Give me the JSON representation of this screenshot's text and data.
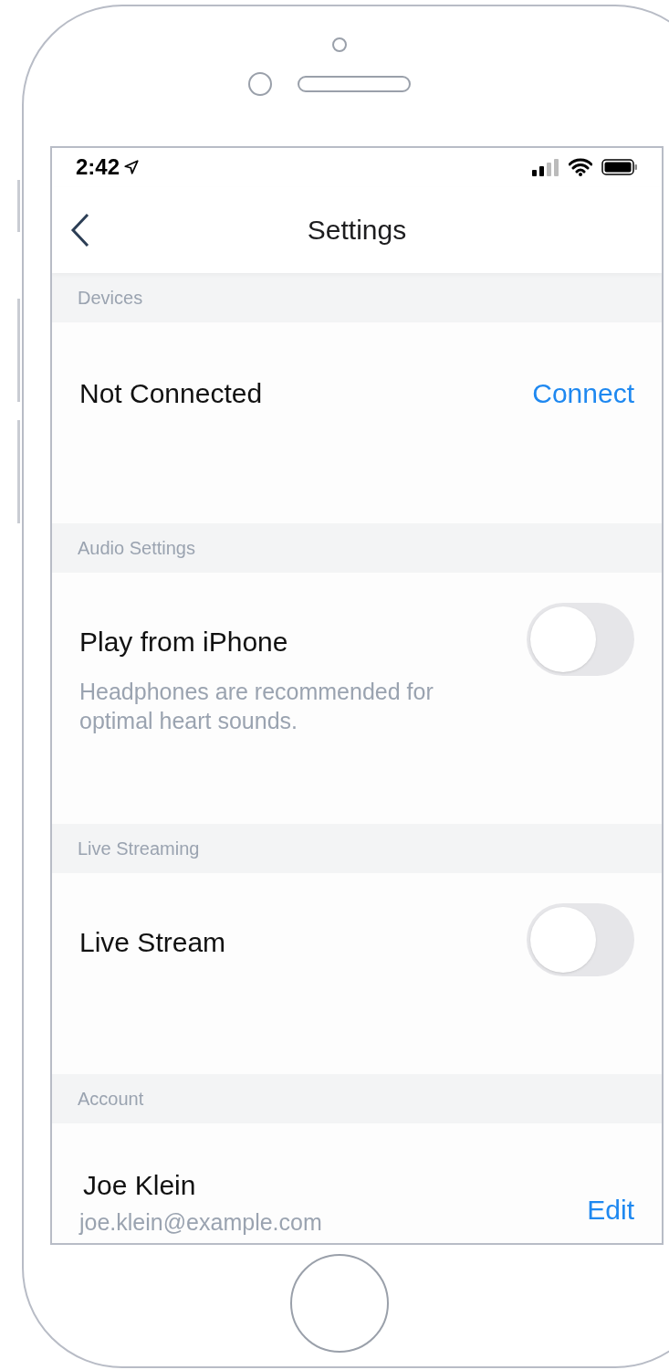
{
  "status_bar": {
    "time": "2:42"
  },
  "nav": {
    "title": "Settings"
  },
  "sections": [
    {
      "header": "Devices",
      "row": {
        "kind": "action",
        "label": "Not Connected",
        "action": "Connect"
      }
    },
    {
      "header": "Audio Settings",
      "row": {
        "kind": "toggle",
        "label": "Play from iPhone",
        "description": "Headphones are recommended for optimal heart sounds.",
        "on": false
      }
    },
    {
      "header": "Live Streaming",
      "row": {
        "kind": "toggle",
        "label": "Live Stream",
        "on": false
      }
    },
    {
      "header": "Account",
      "row": {
        "kind": "account",
        "name": "Joe Klein",
        "email": "joe.klein@example.com",
        "action": "Edit"
      }
    }
  ]
}
